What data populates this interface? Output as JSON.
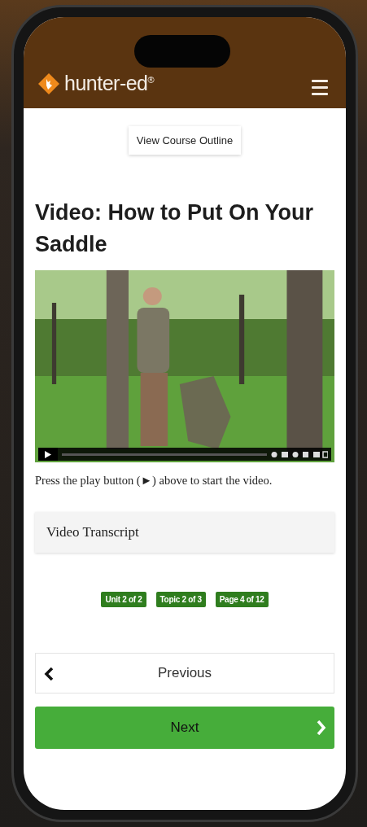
{
  "header": {
    "logo": "hunter-ed$^{®}$"
  },
  "outline_button": "View Course Outline",
  "title": "Video: How to Put On Your Saddle",
  "instruction": "Press the play button (►) above to start the video.",
  "transcript": "Video Transcript",
  "badges": [
    "Unit 2 of 2",
    "Topic 2 of 3",
    "Page 4 of 12"
  ],
  "previous": "Previous",
  "next": "Next"
}
